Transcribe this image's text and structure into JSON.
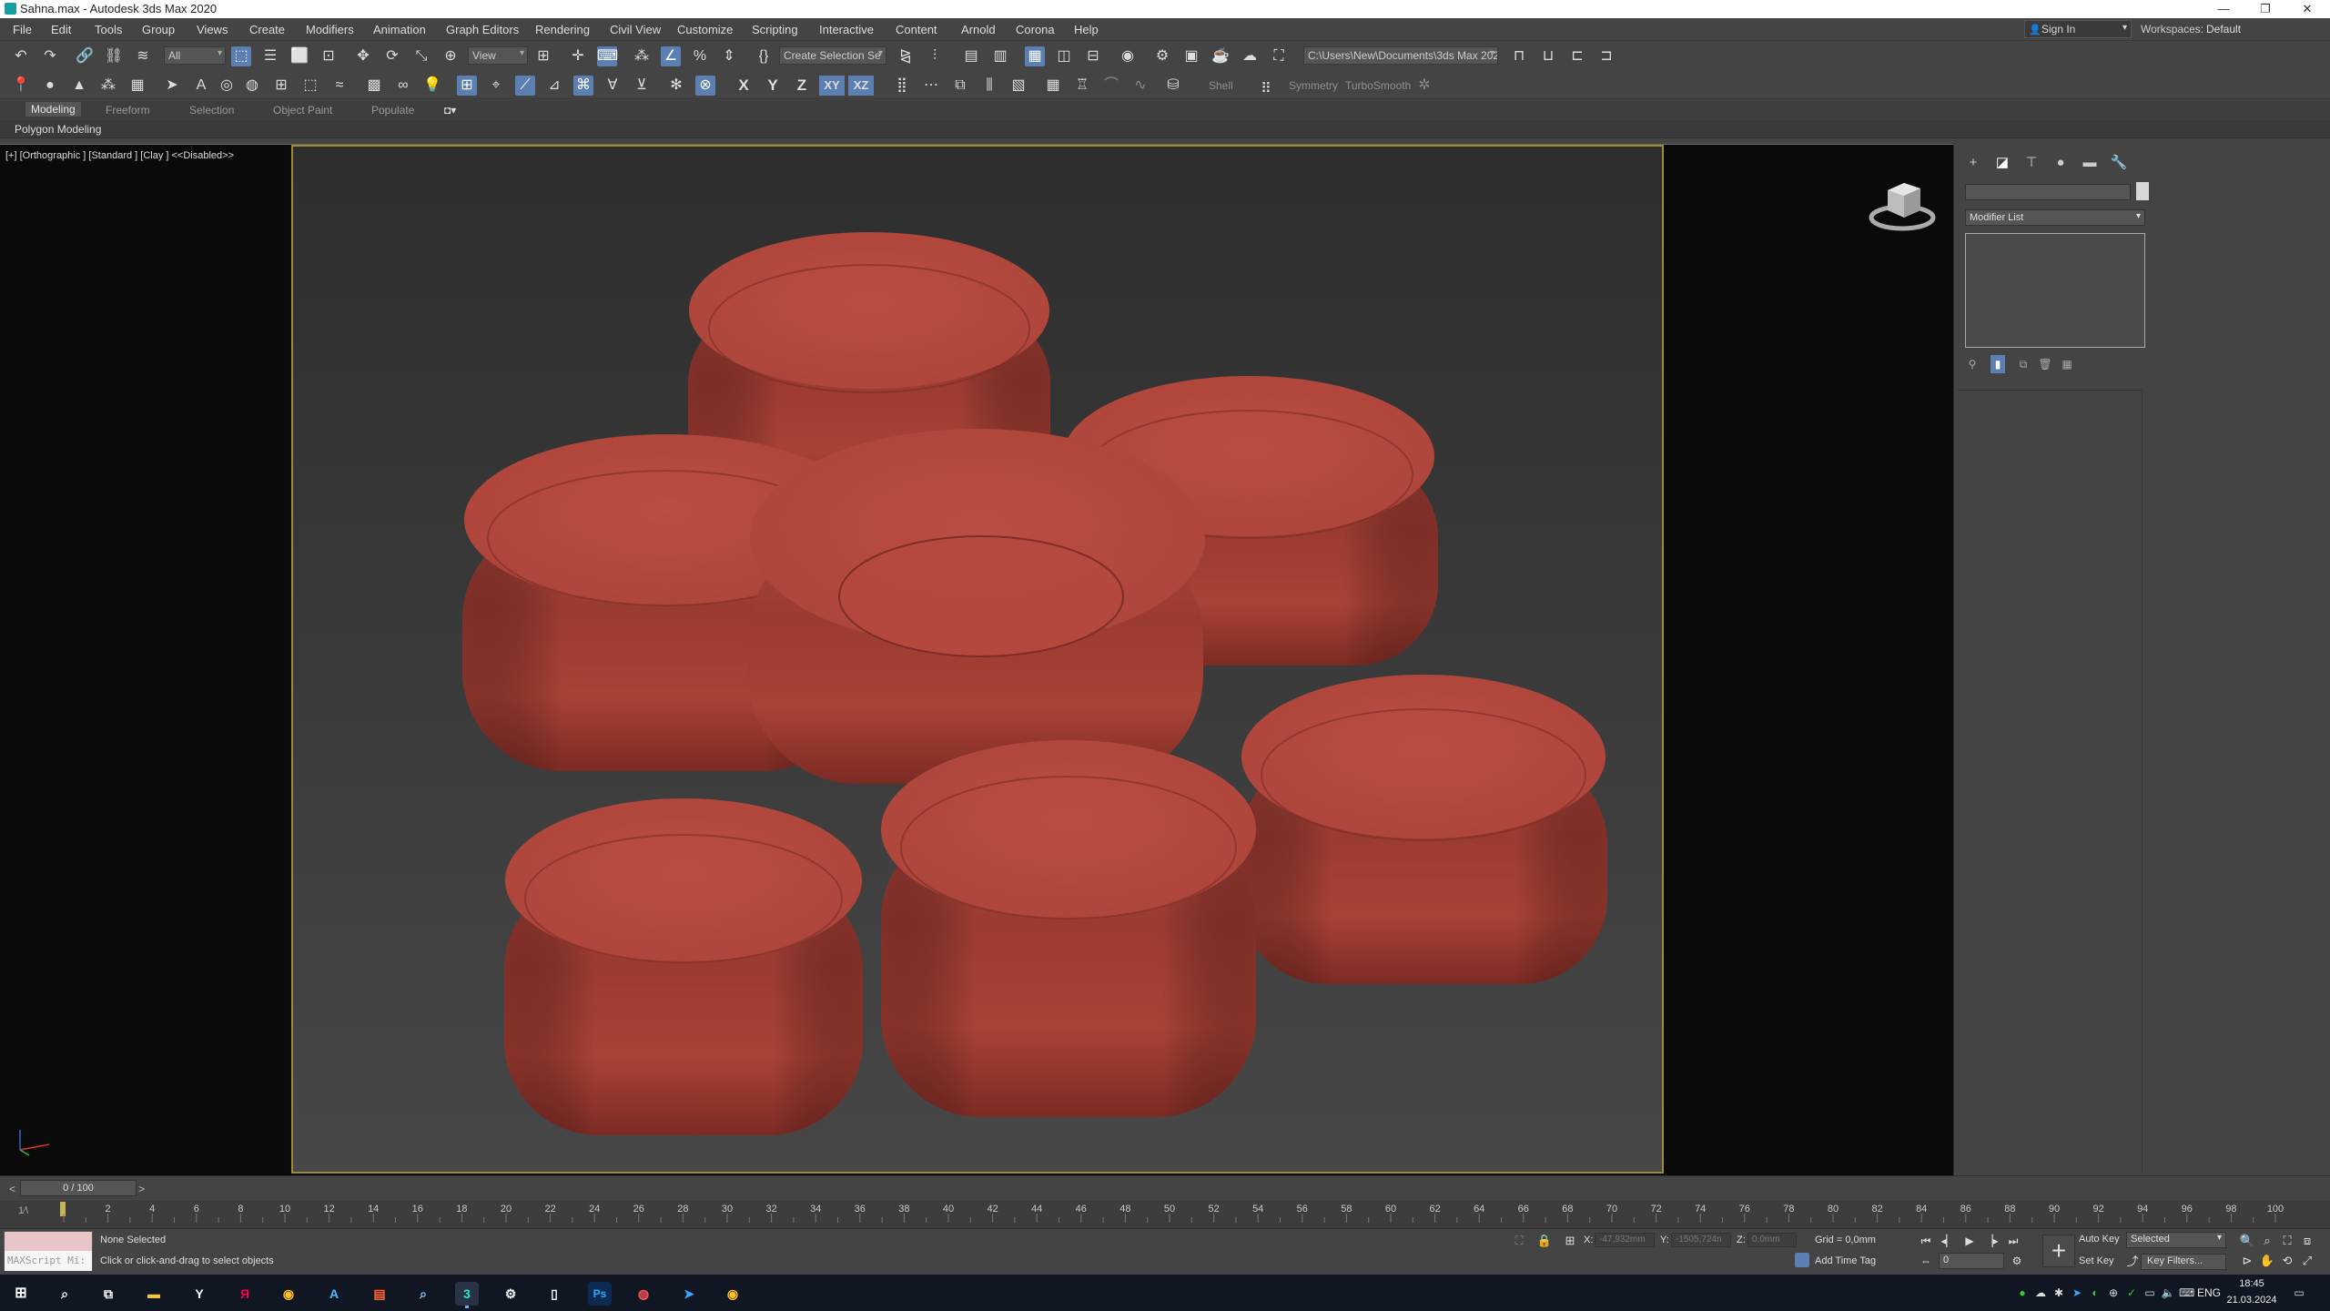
{
  "window": {
    "title": "Sahna.max - Autodesk 3ds Max 2020",
    "min_icon": "minimize-icon",
    "max_icon": "restore-icon",
    "close_icon": "close-icon"
  },
  "menubar": {
    "items": [
      "File",
      "Edit",
      "Tools",
      "Group",
      "Views",
      "Create",
      "Modifiers",
      "Animation",
      "Graph Editors",
      "Rendering",
      "Civil View",
      "Customize",
      "Scripting",
      "Interactive",
      "Content",
      "Arnold",
      "Corona",
      "Help"
    ],
    "sign_in": "Sign In",
    "workspaces_label": "Workspaces:",
    "workspace_value": "Default"
  },
  "toolbar": {
    "selection_filter": "All",
    "ref_coord": "View",
    "named_selection": "Create Selection Se",
    "project_path": "C:\\Users\\New\\Documents\\3ds Max 2020",
    "axis_x": "X",
    "axis_y": "Y",
    "axis_z": "Z",
    "axis_xy": "XY",
    "axis_xz": "XZ",
    "shell_label": "Shell",
    "symmetry_label": "Symmetry",
    "turbosmooth_label": "TurboSmooth"
  },
  "ribbon": {
    "tabs": [
      "Modeling",
      "Freeform",
      "Selection",
      "Object Paint",
      "Populate"
    ],
    "active_tab": "Modeling",
    "panel_label": "Polygon Modeling"
  },
  "viewport": {
    "label": "[+] [Orthographic ] [Standard ] [Clay ]  <<Disabled>>",
    "object_color": "#b8483f"
  },
  "command_panel": {
    "modifier_list": "Modifier List"
  },
  "timeline": {
    "range": "0 / 100",
    "ticks": [
      "2",
      "4",
      "6",
      "8",
      "10",
      "12",
      "14",
      "16",
      "18",
      "20",
      "22",
      "24",
      "26",
      "28",
      "30",
      "32",
      "34",
      "36",
      "38",
      "40",
      "42",
      "44",
      "46",
      "48",
      "50",
      "52",
      "54",
      "56",
      "58",
      "60",
      "62",
      "64",
      "66",
      "68",
      "70",
      "72",
      "74",
      "76",
      "78",
      "80",
      "82",
      "84",
      "86",
      "88",
      "90",
      "92",
      "94",
      "96",
      "98",
      "100"
    ],
    "start_marker": "1⁄\\"
  },
  "status": {
    "maxscript": "MAXScript Mi:",
    "selection": "None Selected",
    "prompt": "Click or click-and-drag to select objects",
    "x_label": "X:",
    "x_value": "-47,932mm",
    "y_label": "Y:",
    "y_value": "-1505,724n",
    "z_label": "Z:",
    "z_value": "0,0mm",
    "grid": "Grid = 0,0mm",
    "add_time_tag": "Add Time Tag",
    "auto_key": "Auto Key",
    "set_key": "Set Key",
    "key_mode": "Selected",
    "key_filters": "Key Filters...",
    "current_frame": "0"
  },
  "taskbar": {
    "lang": "ENG",
    "time": "18:45",
    "date": "21.03.2024"
  }
}
